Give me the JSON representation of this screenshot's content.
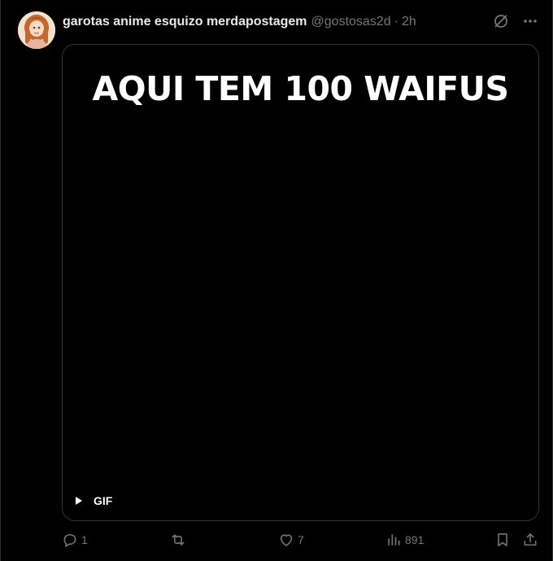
{
  "post": {
    "author": {
      "display_name": "garotas anime esquizo merdapostagem",
      "handle": "@gostosas2d",
      "separator": "·",
      "time": "2h"
    },
    "media": {
      "caption": "AQUI TEM 100 WAIFUS",
      "badge": "GIF"
    },
    "actions": {
      "replies": "1",
      "reposts": "",
      "likes": "7",
      "views": "891"
    }
  },
  "icons": {
    "top_right": [
      "grok-icon",
      "more-icon"
    ],
    "actions": [
      "reply-icon",
      "repost-icon",
      "like-icon",
      "views-icon",
      "bookmark-icon",
      "share-icon"
    ]
  },
  "colors": {
    "background": "#000000",
    "text_primary": "#e7e9ea",
    "text_secondary": "#71767b",
    "border": "#2f3336",
    "media_caption": "#ffffff"
  }
}
